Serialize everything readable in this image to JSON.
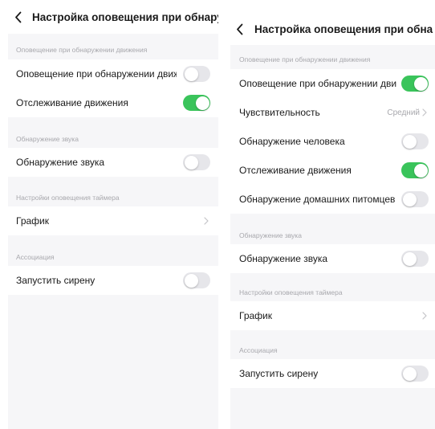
{
  "colors": {
    "toggle_on": "#3ac45b",
    "toggle_off": "#e6e6ea",
    "screen_background": "#f6f6f8",
    "secondary_text": "#a8a8ad"
  },
  "icons": {
    "back": "chevron-left-icon",
    "disclosure": "chevron-right-icon"
  },
  "left_screen": {
    "title": "Настройка оповещения при обнаруж...",
    "sections": {
      "motion": {
        "header": "Оповещение при обнаружении движения",
        "alert_label": "Оповещение при обнаружении движ...",
        "alert_toggle": false,
        "tracking_label": "Отслеживание движения",
        "tracking_toggle": true
      },
      "sound": {
        "header": "Обнаружение звука",
        "detection_label": "Обнаружение звука",
        "detection_toggle": false
      },
      "timer": {
        "header": "Настройки оповещения таймера",
        "schedule_label": "График"
      },
      "association": {
        "header": "Ассоциация",
        "siren_label": "Запустить сирену",
        "siren_toggle": false
      }
    }
  },
  "right_screen": {
    "title": "Настройка оповещения при обнаруж...",
    "sections": {
      "motion": {
        "header": "Оповещение при обнаружении движения",
        "alert_label": "Оповещение при обнаружении движ...",
        "alert_toggle": true,
        "sensitivity_label": "Чувствительность",
        "sensitivity_value": "Средний",
        "human_label": "Обнаружение человека",
        "human_toggle": false,
        "tracking_label": "Отслеживание движения",
        "tracking_toggle": true,
        "pets_label": "Обнаружение домашних питомцев",
        "pets_toggle": false
      },
      "sound": {
        "header": "Обнаружение звука",
        "detection_label": "Обнаружение звука",
        "detection_toggle": false
      },
      "timer": {
        "header": "Настройки оповещения таймера",
        "schedule_label": "График"
      },
      "association": {
        "header": "Ассоциация",
        "siren_label": "Запустить сирену",
        "siren_toggle": false
      }
    }
  }
}
